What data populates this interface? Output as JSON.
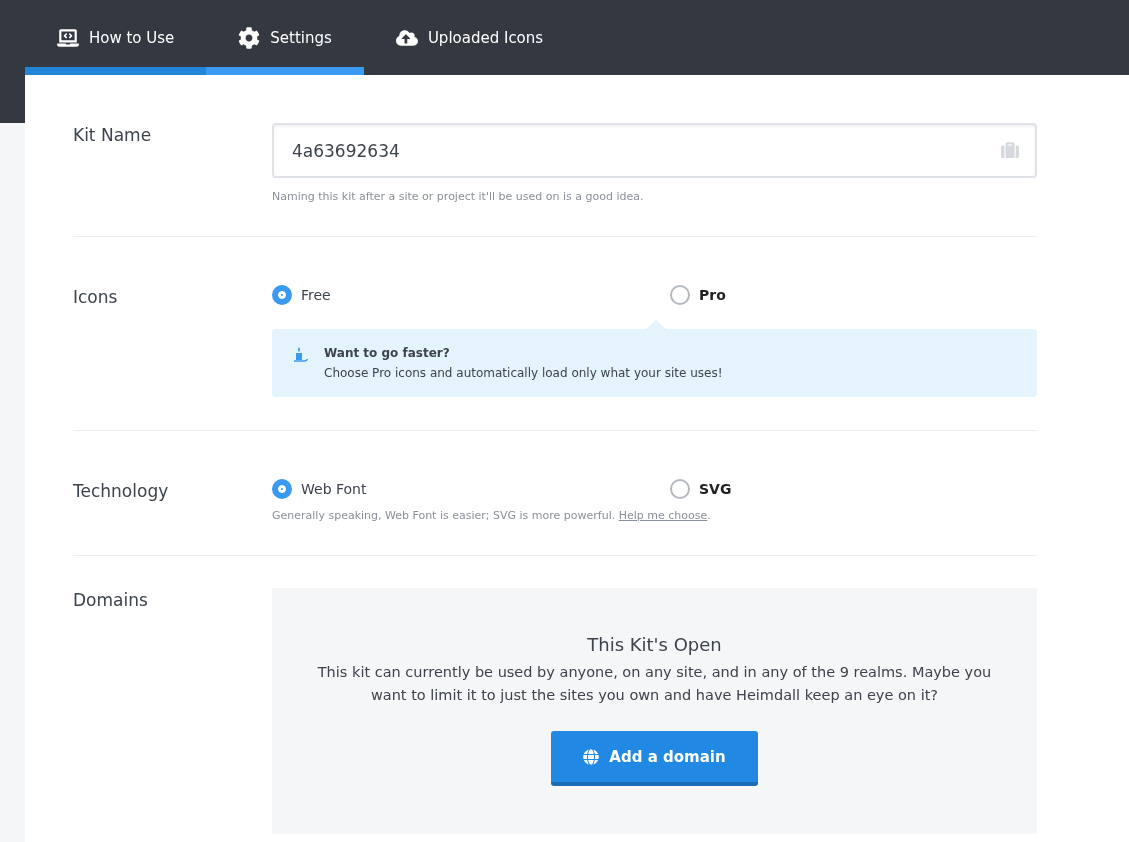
{
  "tabs": [
    {
      "label": "How to Use",
      "selected": false,
      "hovered": true
    },
    {
      "label": "Settings",
      "selected": true,
      "hovered": false
    },
    {
      "label": "Uploaded Icons",
      "selected": false,
      "hovered": false
    }
  ],
  "kit_name": {
    "label": "Kit Name",
    "value": "4a63692634",
    "help": "Naming this kit after a site or project it'll be used on is a good idea."
  },
  "icons": {
    "label": "Icons",
    "options": [
      {
        "label": "Free",
        "selected": true
      },
      {
        "label": "Pro",
        "selected": false
      }
    ],
    "callout": {
      "title": "Want to go faster?",
      "text": "Choose Pro icons and automatically load only what your site uses!"
    }
  },
  "technology": {
    "label": "Technology",
    "options": [
      {
        "label": "Web Font",
        "selected": true
      },
      {
        "label": "SVG",
        "selected": false
      }
    ],
    "help": "Generally speaking, Web Font is easier; SVG is more powerful.",
    "help_link": "Help me choose",
    "help_end": "."
  },
  "domains": {
    "label": "Domains",
    "title": "This Kit's Open",
    "text": "This kit can currently be used by anyone, on any site, and in any of the 9 realms. Maybe you want to limit it to just the sites you own and have Heimdall keep an eye on it?",
    "button": "Add a domain"
  }
}
